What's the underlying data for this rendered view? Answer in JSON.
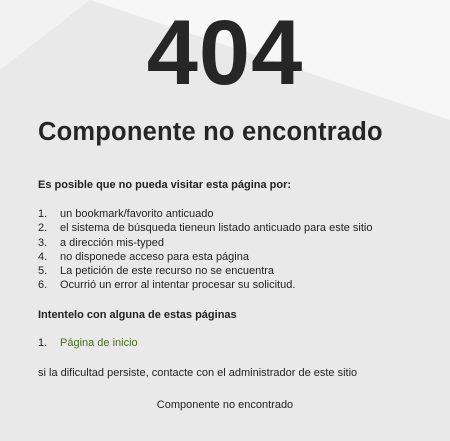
{
  "error_code": "404",
  "title": "Componente no encontrado",
  "intro": "Es posible que no pueda visitar esta página por:",
  "reasons": [
    {
      "num": "1.",
      "text": "un bookmark/favorito anticuado"
    },
    {
      "num": "2.",
      "text": "el sistema de búsqueda tieneun listado anticuado para este sitio"
    },
    {
      "num": "3.",
      "text": "a dirección mis-typed"
    },
    {
      "num": "4.",
      "text": "no disponede acceso para esta página"
    },
    {
      "num": "5.",
      "text": "La petición de este recurso no se encuentra"
    },
    {
      "num": "6.",
      "text": "Ocurrió un error al intentar procesar su solicitud."
    }
  ],
  "try_text": "Intentelo con alguna de estas páginas",
  "pages": [
    {
      "num": "1.",
      "label": "Página de inicio"
    }
  ],
  "persist_text": "si la dificultad persiste, contacte con el administrador de este sitio",
  "footer": "Componente no encontrado",
  "colors": {
    "background": "#e9e9e9",
    "light_panel": "#f7f7f7",
    "link": "#4b6b23",
    "text": "#222222"
  }
}
